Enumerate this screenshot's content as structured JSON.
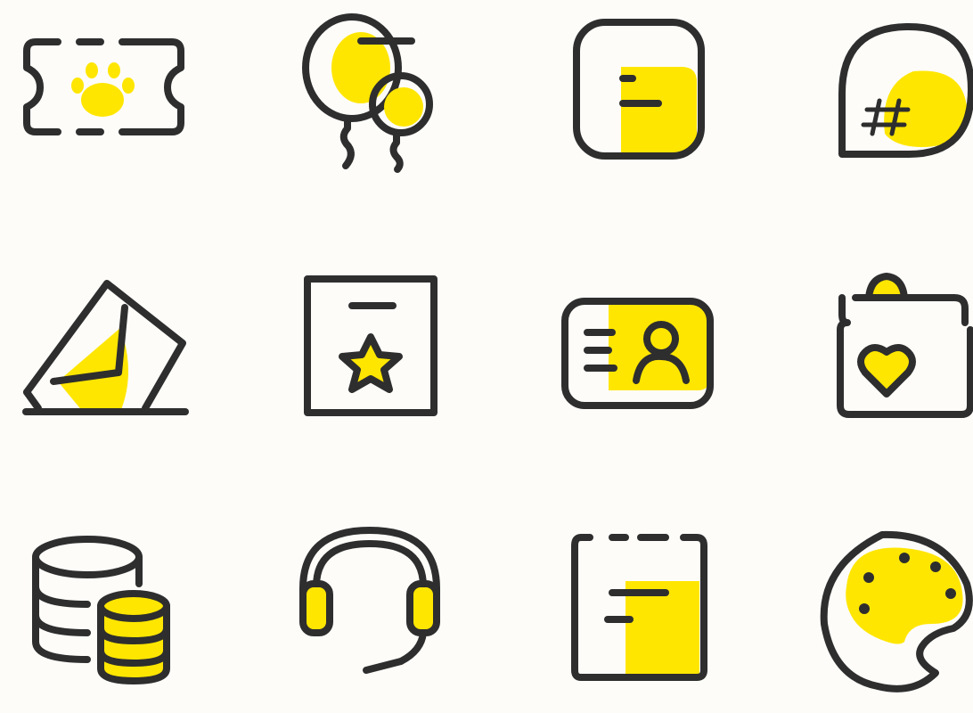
{
  "colors": {
    "accent": "#ffe600",
    "stroke": "#2e2e2e",
    "background": "#fdfcf9"
  },
  "icons": [
    {
      "name": "paw-ticket-icon"
    },
    {
      "name": "balloons-icon"
    },
    {
      "name": "document-icon"
    },
    {
      "name": "hashtag-chat-icon"
    },
    {
      "name": "vote-envelope-icon"
    },
    {
      "name": "star-certificate-icon"
    },
    {
      "name": "id-card-icon"
    },
    {
      "name": "heart-bag-icon"
    },
    {
      "name": "database-coins-icon"
    },
    {
      "name": "headset-icon"
    },
    {
      "name": "notepad-icon"
    },
    {
      "name": "paint-palette-icon"
    }
  ]
}
